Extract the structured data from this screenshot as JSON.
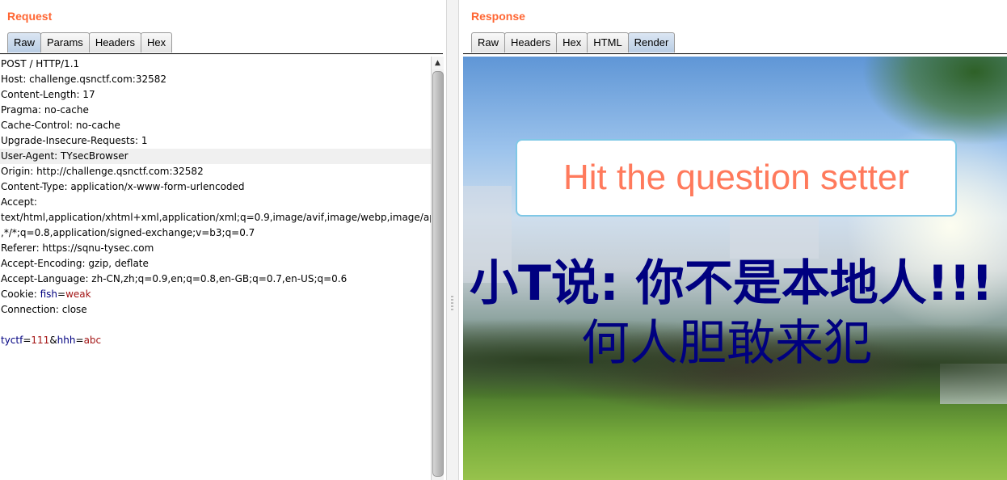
{
  "request": {
    "title": "Request",
    "tabs": [
      {
        "label": "Raw",
        "active": true
      },
      {
        "label": "Params",
        "active": false
      },
      {
        "label": "Headers",
        "active": false
      },
      {
        "label": "Hex",
        "active": false
      }
    ],
    "lines": [
      "POST / HTTP/1.1",
      "Host: challenge.qsnctf.com:32582",
      "Content-Length: 17",
      "Pragma: no-cache",
      "Cache-Control: no-cache",
      "Upgrade-Insecure-Requests: 1",
      "User-Agent: TYsecBrowser",
      "Origin: http://challenge.qsnctf.com:32582",
      "Content-Type: application/x-www-form-urlencoded",
      "Accept:",
      "text/html,application/xhtml+xml,application/xml;q=0.9,image/avif,image/webp,image/apng",
      ",*/*;q=0.8,application/signed-exchange;v=b3;q=0.7",
      "Referer: https://sqnu-tysec.com",
      "Accept-Encoding: gzip, deflate",
      "Accept-Language: zh-CN,zh;q=0.9,en;q=0.8,en-GB;q=0.7,en-US;q=0.6"
    ],
    "cookie": {
      "prefix": "Cookie: ",
      "key": "fish",
      "eq": "=",
      "value": "weak"
    },
    "connection": "Connection: close",
    "body": {
      "k1": "tyctf",
      "eq1": "=",
      "v1": "111",
      "amp": "&",
      "k2": "hhh",
      "eq2": "=",
      "v2": "abc"
    }
  },
  "response": {
    "title": "Response",
    "tabs": [
      {
        "label": "Raw",
        "active": false
      },
      {
        "label": "Headers",
        "active": false
      },
      {
        "label": "Hex",
        "active": false
      },
      {
        "label": "HTML",
        "active": false
      },
      {
        "label": "Render",
        "active": true
      }
    ],
    "hit_button": "Hit the question setter",
    "message_line1": "小T说: 你不是本地人!!!",
    "message_line2": "何人胆敢来犯"
  },
  "icons": {
    "scroll_up": "triangle-up-icon"
  }
}
